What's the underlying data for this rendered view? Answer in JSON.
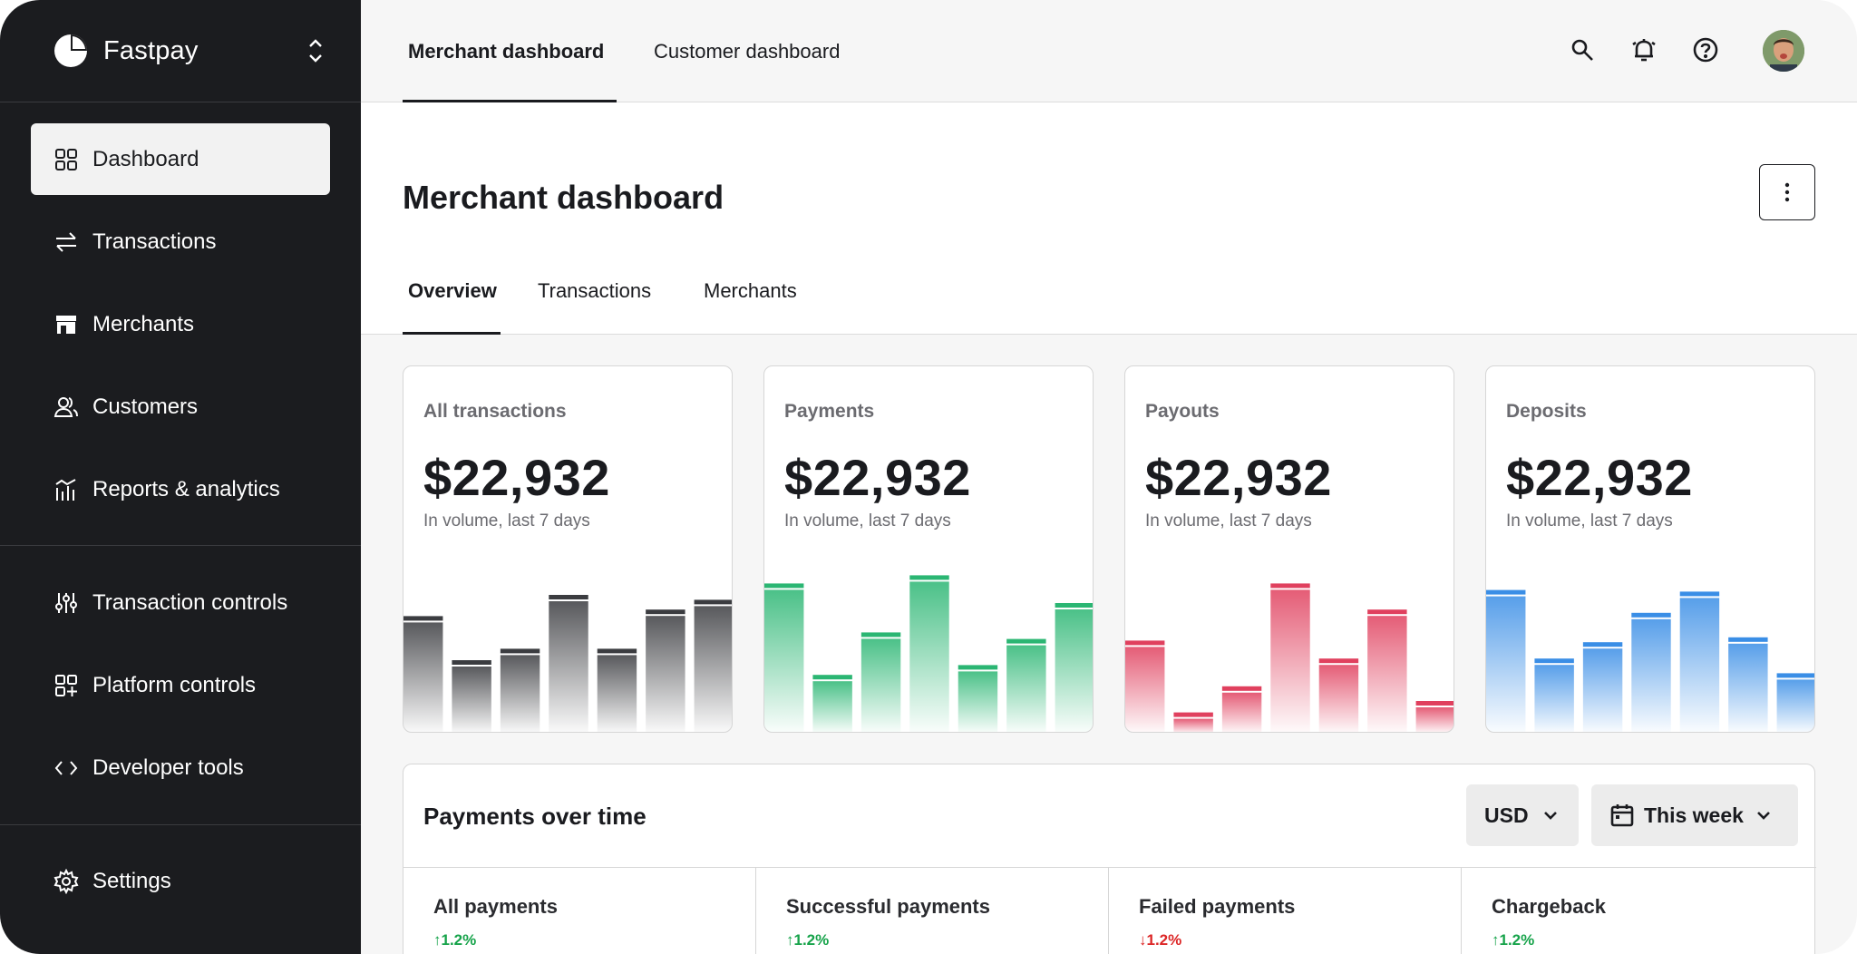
{
  "app": {
    "name": "Fastpay"
  },
  "sidebar": {
    "items": [
      {
        "label": "Dashboard",
        "icon": "grid-icon",
        "active": true
      },
      {
        "label": "Transactions",
        "icon": "arrows-swap-icon"
      },
      {
        "label": "Merchants",
        "icon": "store-icon"
      },
      {
        "label": "Customers",
        "icon": "users-icon"
      },
      {
        "label": "Reports & analytics",
        "icon": "bar-chart-icon"
      },
      {
        "label": "Transaction controls",
        "icon": "sliders-icon"
      },
      {
        "label": "Platform controls",
        "icon": "grid-plus-icon"
      },
      {
        "label": "Developer tools",
        "icon": "code-icon"
      },
      {
        "label": "Settings",
        "icon": "gear-icon"
      }
    ]
  },
  "topbar": {
    "tabs": [
      {
        "label": "Merchant dashboard",
        "active": true
      },
      {
        "label": "Customer dashboard"
      }
    ],
    "icons": [
      "search-icon",
      "bell-icon",
      "help-icon",
      "avatar"
    ]
  },
  "page": {
    "title": "Merchant dashboard",
    "tabs": [
      {
        "label": "Overview",
        "active": true
      },
      {
        "label": "Transactions"
      },
      {
        "label": "Merchants"
      }
    ]
  },
  "cards": [
    {
      "title": "All transactions",
      "value": "$22,932",
      "subtitle": "In volume, last 7 days",
      "color": "#3b3c40",
      "bars": [
        0.72,
        0.45,
        0.52,
        0.85,
        0.52,
        0.76,
        0.82
      ]
    },
    {
      "title": "Payments",
      "value": "$22,932",
      "subtitle": "In volume, last 7 days",
      "color": "#2bb673",
      "bars": [
        0.92,
        0.36,
        0.62,
        0.97,
        0.42,
        0.58,
        0.8
      ]
    },
    {
      "title": "Payouts",
      "value": "$22,932",
      "subtitle": "In volume, last 7 days",
      "color": "#e0405e",
      "bars": [
        0.57,
        0.13,
        0.29,
        0.92,
        0.46,
        0.76,
        0.2
      ]
    },
    {
      "title": "Deposits",
      "value": "$22,932",
      "subtitle": "In volume, last 7 days",
      "color": "#3a8ee6",
      "bars": [
        0.88,
        0.46,
        0.56,
        0.74,
        0.87,
        0.59,
        0.37
      ]
    }
  ],
  "payments_over_time": {
    "title": "Payments over time",
    "currency": "USD",
    "period": "This week",
    "metrics": [
      {
        "label": "All payments",
        "change": "1.2%",
        "direction": "up",
        "color": "#16a34a"
      },
      {
        "label": "Successful payments",
        "change": "1.2%",
        "direction": "up",
        "color": "#16a34a"
      },
      {
        "label": "Failed payments",
        "change": "1.2%",
        "direction": "down",
        "color": "#dc2626"
      },
      {
        "label": "Chargeback",
        "change": "1.2%",
        "direction": "up",
        "color": "#16a34a"
      }
    ]
  }
}
